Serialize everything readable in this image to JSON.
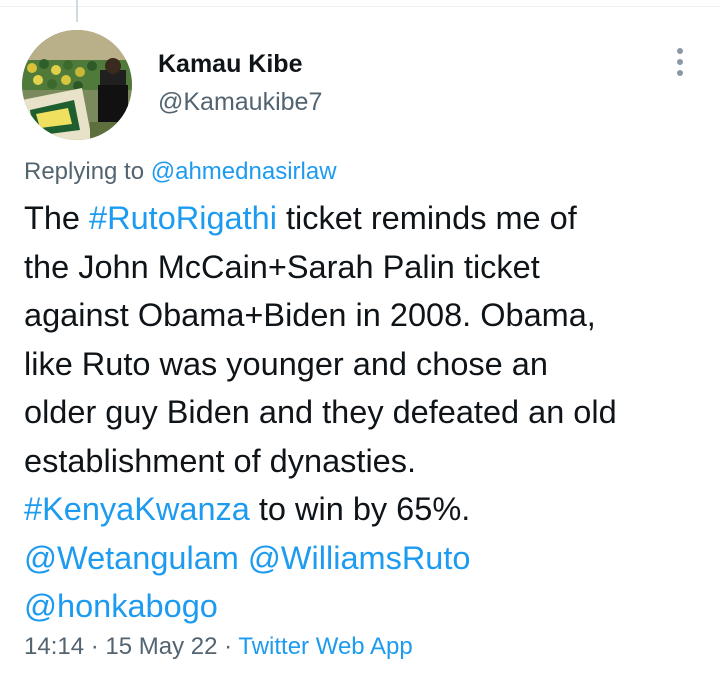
{
  "author": {
    "name": "Kamau Kibe",
    "handle": "@Kamaukibe7"
  },
  "reply": {
    "prefix": "Replying to",
    "handle": "@ahmednasirlaw"
  },
  "tweet": {
    "l1_a": "The ",
    "l1_tag": "#RutoRigathi",
    "l1_b": " ticket reminds me of",
    "l2": "the John McCain+Sarah Palin ticket",
    "l3": "against Obama+Biden in 2008. Obama,",
    "l4": "like Ruto was younger and chose an",
    "l5": "older guy Biden and they defeated an old",
    "l6": "establishment of dynasties.",
    "l7_tag": "#KenyaKwanza",
    "l7_b": " to win by 65%.",
    "mention1": "@Wetangulam",
    "mention2": "@WilliamsRuto",
    "mention3": "@honkabogo"
  },
  "meta": {
    "time": "14:14",
    "sep1": " · ",
    "date": "15 May 22",
    "sep2": " · ",
    "source": "Twitter Web App"
  },
  "icons": {
    "more": "more-options-icon",
    "avatar": "profile-photo"
  },
  "colors": {
    "link": "#1d9bf0",
    "secondary_text": "#536471",
    "primary_text": "#0f1419"
  }
}
